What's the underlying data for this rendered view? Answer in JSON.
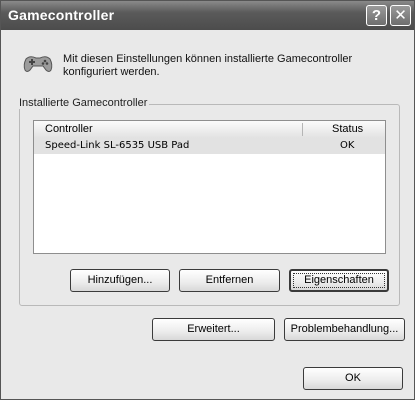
{
  "window": {
    "title": "Gamecontroller",
    "help_glyph": "?",
    "close_glyph": "✕"
  },
  "intro": {
    "icon": "gamepad-icon",
    "line1": "Mit diesen Einstellungen können installierte Gamecontroller",
    "line2": "konfiguriert werden."
  },
  "group": {
    "legend": "Installierte Gamecontroller",
    "columns": {
      "controller": "Controller",
      "status": "Status"
    },
    "rows": [
      {
        "name": "Speed-Link SL-6535 USB Pad",
        "status": "OK"
      }
    ]
  },
  "buttons": {
    "add": "Hinzufügen...",
    "remove": "Entfernen",
    "properties": "Eigenschaften",
    "advanced": "Erweitert...",
    "troubleshoot": "Problembehandlung...",
    "ok": "OK"
  }
}
